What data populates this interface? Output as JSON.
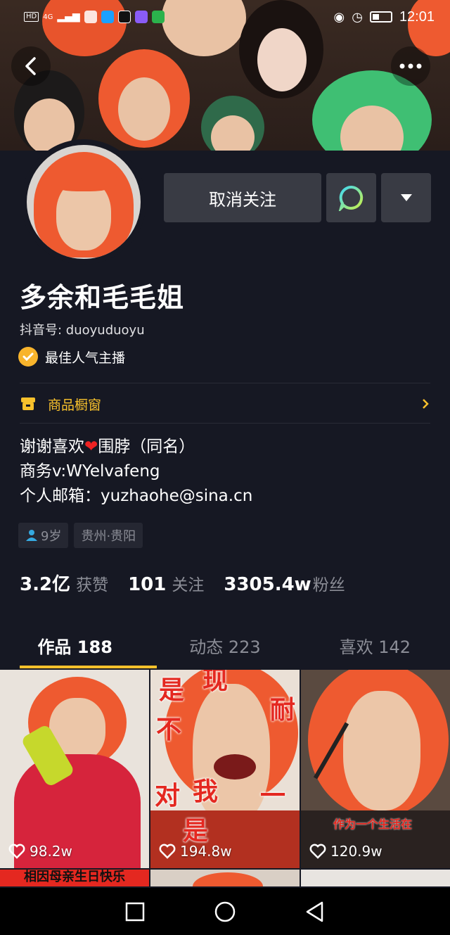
{
  "status_bar": {
    "network": "4G",
    "chip": "HD",
    "time": "12:01"
  },
  "profile": {
    "unfollow_label": "取消关注",
    "nickname": "多余和毛毛姐",
    "douyin_id": "抖音号: duoyuduoyu",
    "badge": "最佳人气主播",
    "shop_window": "商品橱窗",
    "bio": [
      "谢谢喜欢",
      "围脖（同名）",
      "商务v:WYelvafeng",
      "个人邮箱：yuzhaohe@sina.cn"
    ],
    "tags": {
      "age": "9岁",
      "location": "贵州·贵阳"
    }
  },
  "stats": [
    {
      "num": "3.2亿",
      "label": "获赞"
    },
    {
      "num": "101",
      "label": "关注"
    },
    {
      "num": "3305.4w",
      "label": "粉丝"
    }
  ],
  "tabs": [
    {
      "label": "作品 188"
    },
    {
      "label": "动态 223"
    },
    {
      "label": "喜欢 142"
    }
  ],
  "videos": [
    {
      "likes": "98.2w",
      "caption": "相因母亲生日快乐"
    },
    {
      "likes": "194.8w",
      "overlay": [
        "是",
        "现",
        "不",
        "耐",
        "对",
        "我",
        "一",
        "是"
      ]
    },
    {
      "likes": "120.9w",
      "caption": "作为一个生活在"
    }
  ],
  "colors": {
    "background": "#161823",
    "accent": "#f8c12c",
    "button": "#393b44",
    "muted": "#8b8d96"
  },
  "icons": {
    "back": "back-arrow-icon",
    "more": "more-dots-icon",
    "message": "chat-bubble-icon",
    "dropdown": "triangle-down-icon",
    "badge": "check-badge-icon",
    "shop": "shop-icon",
    "age": "person-icon",
    "like": "heart-outline-icon"
  }
}
